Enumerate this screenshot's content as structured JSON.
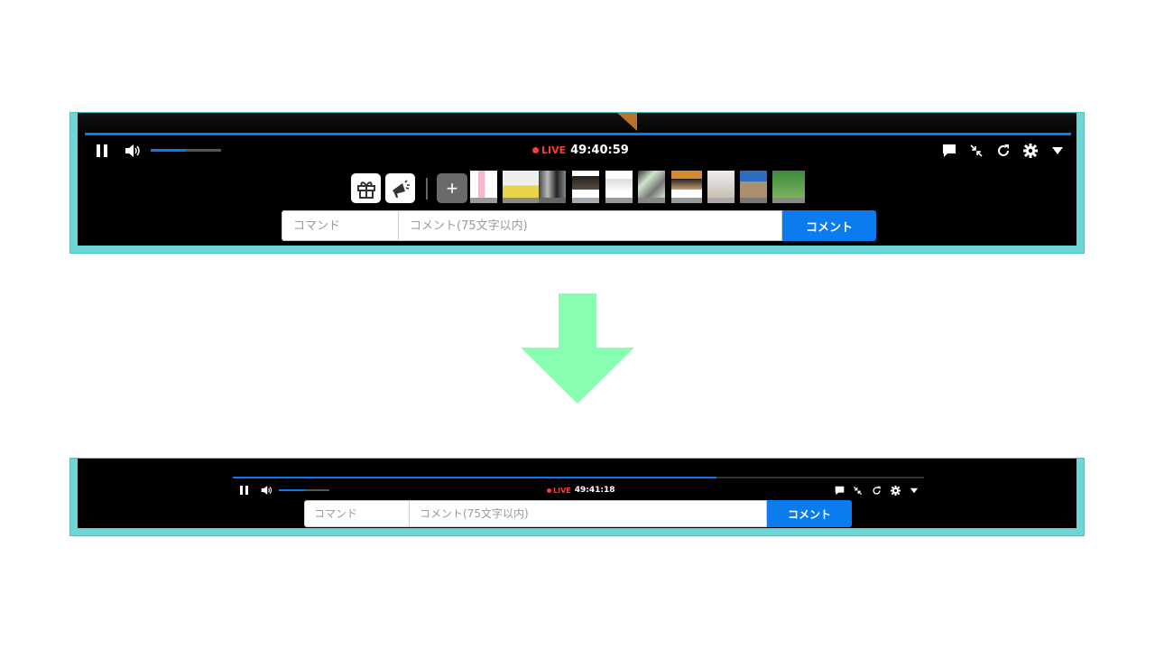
{
  "before": {
    "live_label": "LIVE",
    "time": "49:40:59",
    "volume_level": 0.5,
    "buttons": {
      "pause": "pause-icon",
      "volume": "volume-icon",
      "comment_toggle": "comment-icon",
      "shrink": "shrink-icon",
      "reload": "reload-icon",
      "settings": "gear-icon",
      "menu": "caret-down-icon",
      "gift": "gift-icon",
      "megaphone": "megaphone-icon",
      "add": "+"
    },
    "stamps_count": 10,
    "command_placeholder": "コマンド",
    "comment_placeholder": "コメント(75文字以内)",
    "submit_label": "コメント"
  },
  "after": {
    "live_label": "LIVE",
    "time": "49:41:18",
    "seek_progress": 0.7,
    "volume_level": 0.5,
    "command_placeholder": "コマンド",
    "comment_placeholder": "コメント(75文字以内)",
    "submit_label": "コメント"
  },
  "colors": {
    "frame": "#6ad7d9",
    "accent": "#0a7cf0",
    "live": "#ff3838",
    "arrow": "#88ffb0"
  }
}
